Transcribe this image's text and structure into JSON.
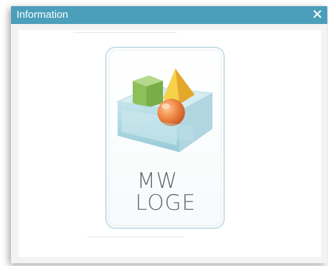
{
  "dialog": {
    "title": "Information",
    "close_icon": "close-icon",
    "colors": {
      "titlebar": "#4c9fba",
      "title_text": "#ffffff",
      "frame": "#f3f3f3",
      "content": "#ffffff"
    }
  },
  "logo": {
    "line1": "MW",
    "line2": "LOGE",
    "icons": [
      "cube-icon",
      "pyramid-icon",
      "sphere-icon",
      "tray-icon"
    ],
    "colors": {
      "cube": "#8dbf5a",
      "pyramid": "#f0c030",
      "sphere": "#e8743a",
      "tray": "#a8d4df",
      "text": "#5f6a70"
    }
  }
}
